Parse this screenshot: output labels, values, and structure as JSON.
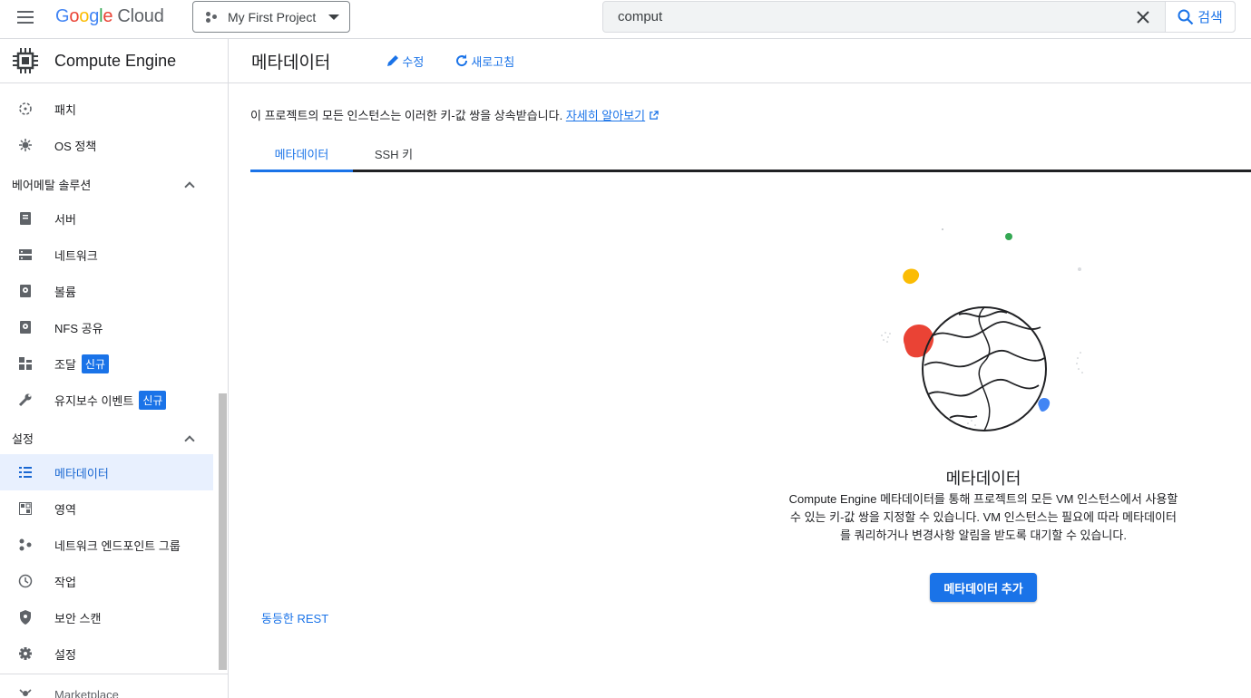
{
  "topbar": {
    "logo_google": "Google",
    "logo_cloud": "Cloud",
    "project_name": "My First Project",
    "search_value": "comput",
    "search_button": "검색"
  },
  "sidebar": {
    "product_name": "Compute Engine",
    "items_top": [
      {
        "label": "패치",
        "icon": "patch-icon"
      },
      {
        "label": "OS 정책",
        "icon": "os-policy-icon"
      }
    ],
    "section_baremetal": "베어메탈 솔루션",
    "items_baremetal": [
      {
        "label": "서버",
        "icon": "server-icon"
      },
      {
        "label": "네트워크",
        "icon": "network-icon"
      },
      {
        "label": "볼륨",
        "icon": "volume-icon"
      },
      {
        "label": "NFS 공유",
        "icon": "nfs-share-icon"
      },
      {
        "label": "조달",
        "icon": "procurement-icon",
        "badge": "신규"
      },
      {
        "label": "유지보수 이벤트",
        "icon": "wrench-icon",
        "badge": "신규"
      }
    ],
    "section_settings": "설정",
    "items_settings": [
      {
        "label": "메타데이터",
        "icon": "metadata-icon",
        "active": true
      },
      {
        "label": "영역",
        "icon": "zones-icon"
      },
      {
        "label": "네트워크 엔드포인트 그룹",
        "icon": "endpoint-group-icon"
      },
      {
        "label": "작업",
        "icon": "clock-icon"
      },
      {
        "label": "보안 스캔",
        "icon": "shield-icon"
      },
      {
        "label": "설정",
        "icon": "gear-icon"
      }
    ],
    "marketplace": "Marketplace"
  },
  "main": {
    "title": "메타데이터",
    "edit_label": "수정",
    "refresh_label": "새로고침",
    "description": "이 프로젝트의 모든 인스턴스는 이러한 키-값 쌍을 상속받습니다.",
    "learn_more": "자세히 알아보기",
    "tabs": [
      "메타데이터",
      "SSH 키"
    ],
    "empty_title": "메타데이터",
    "empty_desc_1": "Compute Engine 메타데이터를 통해 프로젝트의 모든 VM 인스턴스에서 사용할",
    "empty_desc_2": "수 있는 키-값 쌍을 지정할 수 있습니다. VM 인스턴스는 필요에 따라 메타데이터",
    "empty_desc_3": "를 쿼리하거나 변경사항 알림을 받도록 대기할 수 있습니다.",
    "add_button": "메타데이터 추가",
    "rest_link": "동등한 REST"
  },
  "colors": {
    "accent": "#1a73e8",
    "active_bg": "#e8f0fe",
    "blob_red": "#ea4335",
    "blob_yellow": "#fbbc04",
    "blob_blue": "#4285f4",
    "dot_green": "#34a853"
  }
}
